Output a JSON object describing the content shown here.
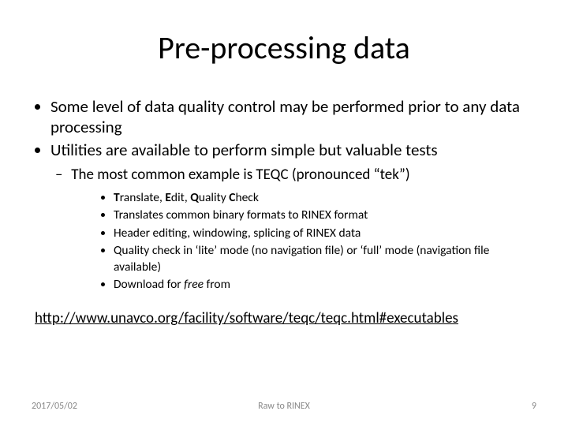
{
  "title": "Pre-processing data",
  "bullets": {
    "a": "Some level of data quality control may be performed prior to any data processing",
    "b": "Utilities are available to perform simple but valuable tests",
    "b1": "The most common example is TEQC (pronounced “tek”)",
    "b1a_prefix": "T",
    "b1a_mid1": "ranslate, ",
    "b1a_mid2": "E",
    "b1a_mid3": "dit, ",
    "b1a_mid4": "Q",
    "b1a_mid5": "uality ",
    "b1a_mid6": "C",
    "b1a_suffix": "heck",
    "b1b": "Translates common  binary formats to RINEX format",
    "b1c": "Header editing, windowing, splicing of RINEX data",
    "b1d": "Quality check in ‘lite’ mode (no navigation file) or ‘full’ mode (navigation file available)",
    "b1e_pre": "Download for ",
    "b1e_em": "free",
    "b1e_post": " from"
  },
  "link": "http://www.unavco.org/facility/software/teqc/teqc.html#executables",
  "footer": {
    "date": "2017/05/02",
    "center": "Raw to RINEX",
    "page": "9"
  }
}
